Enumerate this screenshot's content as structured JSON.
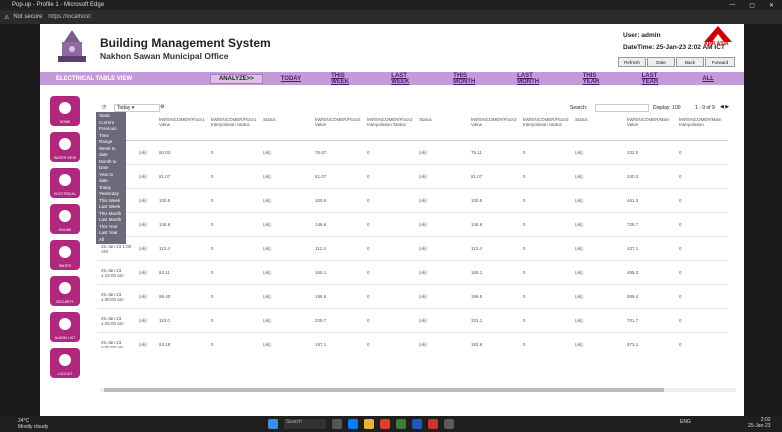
{
  "browser": {
    "tab_title": "Pop-up - Profile 1 - Microsoft Edge",
    "security_label": "Not secure",
    "url": "https://localhost:",
    "window_controls": [
      "—",
      "▢",
      "✕"
    ]
  },
  "header": {
    "title": "Building Management System",
    "subtitle": "Nakhon Sawan Municipal Office",
    "user": "User: admin",
    "datetime": "DateTime: 25-Jan-23 2:02 AM ICT",
    "brand": "AMR ASIA",
    "buttons": [
      "Refresh",
      "Date",
      "Back",
      "Forward"
    ]
  },
  "nav": {
    "view_name": "ELECTRICAL TABLE VIEW",
    "analyze": "ANALYZE>>",
    "links": [
      "TODAY",
      "THIS WEEK",
      "LAST WEEK",
      "THIS MONTH",
      "LAST MONTH",
      "THIS YEAR",
      "LAST YEAR",
      "ALL"
    ]
  },
  "sidebar": [
    "HOME",
    "WATER VIEW",
    "ELECTRICAL",
    "ONLINE",
    "WATER",
    "SECURITY",
    "ALARM LIST",
    "LOGOUT"
  ],
  "toolbar": {
    "range_value": "Today",
    "search_label": "Search:",
    "display_label": "Display: 100",
    "paging": "1 - 9 of 9"
  },
  "dropdown_options": [
    "Static",
    "Current",
    "Previous",
    "Time Range",
    "Week to date",
    "Month to Date",
    "Year to date",
    "Today",
    "Yesterday",
    "This Week",
    "Last Week",
    "This Month",
    "Last Month",
    "This Year",
    "Last Year",
    "All"
  ],
  "table": {
    "columns": [
      "Time",
      "",
      "kWh/INCOMER/Floor1 Value",
      "kWh/INCOMER/Floor1 Interpolation Status",
      "Status",
      "kWh/INCOMER/Floor2 Value",
      "kWh/INCOMER/Floor2 Interpolation Status",
      "Status",
      "kWh/INCOMER/Floor3 Value",
      "kWh/INCOMER/Floor3 Interpolation Status",
      "Status",
      "kWh/INCOMER/Main Value",
      "kWh/INCOMER/Main Interpolation"
    ],
    "rows": [
      [
        "25-Jan-23 12:00 AM",
        "(ok)",
        "80.03",
        "0",
        "(ok)",
        "76.87",
        "0",
        "(ok)",
        "75.11",
        "0",
        "(ok)",
        "232.0",
        "0"
      ],
      [
        "25-Jan-23 12:15 AM",
        "(ok)",
        "81.07",
        "0",
        "(ok)",
        "81.07",
        "0",
        "(ok)",
        "81.07",
        "0",
        "(ok)",
        "240.3",
        "0"
      ],
      [
        "25-Jan-23 12:30 AM",
        "(ok)",
        "100.5",
        "0",
        "(ok)",
        "100.5",
        "0",
        "(ok)",
        "100.5",
        "0",
        "(ok)",
        "461.3",
        "0"
      ],
      [
        "25-Jan-23 12:45 AM",
        "(ok)",
        "146.6",
        "0",
        "(ok)",
        "146.6",
        "0",
        "(ok)",
        "146.6",
        "0",
        "(ok)",
        "726.7",
        "0"
      ],
      [
        "25-Jan-23 1:00 AM",
        "(ok)",
        "112.4",
        "0",
        "(ok)",
        "112.4",
        "0",
        "(ok)",
        "112.4",
        "0",
        "(ok)",
        "437.1",
        "0"
      ],
      [
        "25-Jan-23 1:15:00 am",
        "(ok)",
        "83.11",
        "0",
        "(ok)",
        "165.1",
        "0",
        "(ok)",
        "165.1",
        "0",
        "(ok)",
        "495.3",
        "0"
      ],
      [
        "25-Jan-23 1:30:00 am",
        "(ok)",
        "96.40",
        "0",
        "(ok)",
        "196.5",
        "0",
        "(ok)",
        "196.5",
        "0",
        "(ok)",
        "589.4",
        "0"
      ],
      [
        "25-Jan-23 1:45:00 am",
        "(ok)",
        "110.0",
        "0",
        "(ok)",
        "229.7",
        "0",
        "(ok)",
        "331.1",
        "0",
        "(ok)",
        "701.7",
        "0"
      ],
      [
        "25-Jan-23 2:00:00 am",
        "(ok)",
        "93.18",
        "0",
        "(ok)",
        "197.1",
        "0",
        "(ok)",
        "192.6",
        "0",
        "(ok)",
        "573.1",
        "0"
      ]
    ]
  },
  "taskbar": {
    "weather_temp": "24°C",
    "weather_text": "Mostly cloudy",
    "search": "Search",
    "lang": "ENG",
    "time": "2:02",
    "date": "25-Jan-23"
  },
  "colors": {
    "accent": "#b0287d",
    "nav": "#c69ad9",
    "brand_red": "#cc0000"
  }
}
